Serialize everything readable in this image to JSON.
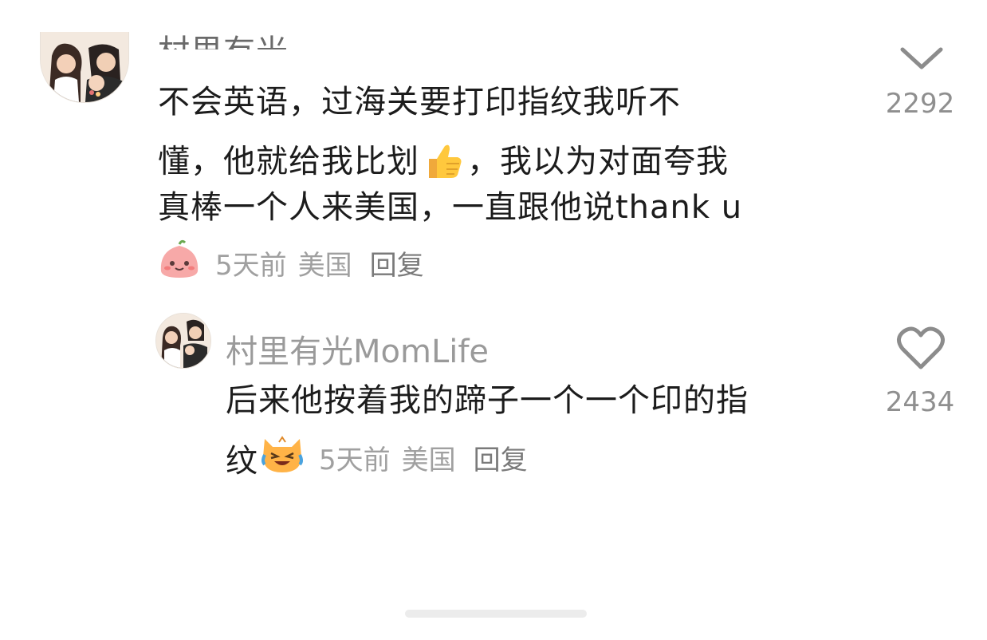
{
  "comment1": {
    "line1": "不会英语，过海关要打印指纹我听不",
    "line2_a": "懂，他就给我比划",
    "line2_b": "，我以为对面夸我",
    "line3": "真棒一个人来美国，一直跟他说thank u",
    "inline_emoji": "thumbs-up",
    "badge_emoji": "pink-bun-sticker",
    "time": "5天前",
    "location": "美国",
    "reply_label": "回复",
    "like_count": "2292",
    "like_icon": "chevron-down-icon"
  },
  "comment2": {
    "username": "村里有光MomLife",
    "line1": "后来他按着我的蹄子一个一个印的指",
    "line2": "纹",
    "inline_emoji": "crying-laughing-cat",
    "time": "5天前",
    "location": "美国",
    "reply_label": "回复",
    "like_count": "2434",
    "like_icon": "heart-outline-icon"
  },
  "colors": {
    "text": "#1c1c1c",
    "meta": "#a0a0a0",
    "username": "#9a9a9a",
    "like_count": "#8f8f8f"
  }
}
